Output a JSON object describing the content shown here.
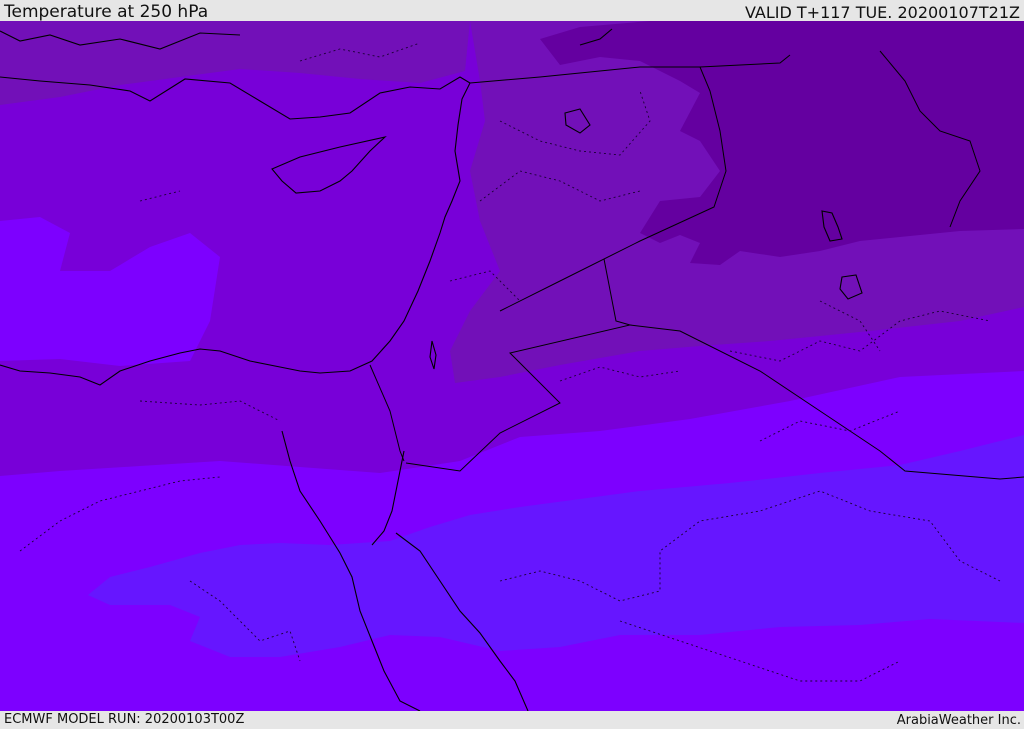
{
  "header": {
    "title": "Temperature at 250 hPa",
    "valid": "VALID T+117 TUE. 20200107T21Z"
  },
  "footer": {
    "model_run": "ECMWF MODEL RUN: 20200103T00Z",
    "credit": "ArabiaWeather Inc."
  },
  "colors": {
    "band_coldest": "#6400a0",
    "band_cold": "#7210b8",
    "band_mid": "#7800d8",
    "band_warm": "#7d00ff",
    "band_warmest": "#6616ff",
    "coastline": "#000000",
    "border": "#1a0033"
  }
}
